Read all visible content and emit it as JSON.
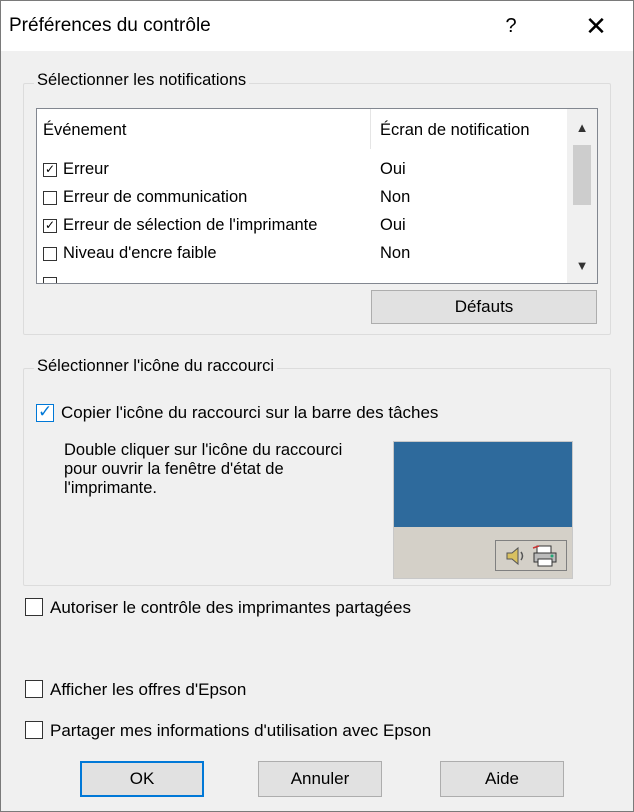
{
  "dialog": {
    "title": "Préférences du contrôle",
    "help_symbol": "?",
    "close_symbol": "✕"
  },
  "notifications": {
    "group_label": "Sélectionner les notifications",
    "col_event": "Événement",
    "col_screen": "Écran de notification",
    "rows": [
      {
        "event": "Erreur",
        "value": "Oui",
        "checked": true
      },
      {
        "event": "Erreur de communication",
        "value": "Non",
        "checked": false
      },
      {
        "event": "Erreur de sélection de l'imprimante",
        "value": "Oui",
        "checked": true
      },
      {
        "event": "Niveau d'encre faible",
        "value": "Non",
        "checked": false
      }
    ],
    "defaults_button": "Défauts"
  },
  "shortcut": {
    "group_label": "Sélectionner l'icône du raccourci",
    "copy_label": "Copier l'icône du raccourci sur la barre des tâches",
    "copy_checked": true,
    "description": "Double cliquer sur l'icône du raccourci pour ouvrir la fenêtre d'état de l'imprimante."
  },
  "options": {
    "shared_label": "Autoriser le contrôle des imprimantes partagées",
    "offers_label": "Afficher les offres d'Epson",
    "usage_label": "Partager mes informations d'utilisation avec Epson"
  },
  "buttons": {
    "ok": "OK",
    "cancel": "Annuler",
    "help": "Aide"
  },
  "colors": {
    "accent": "#0078d7",
    "preview_blue": "#2e6a9c"
  }
}
